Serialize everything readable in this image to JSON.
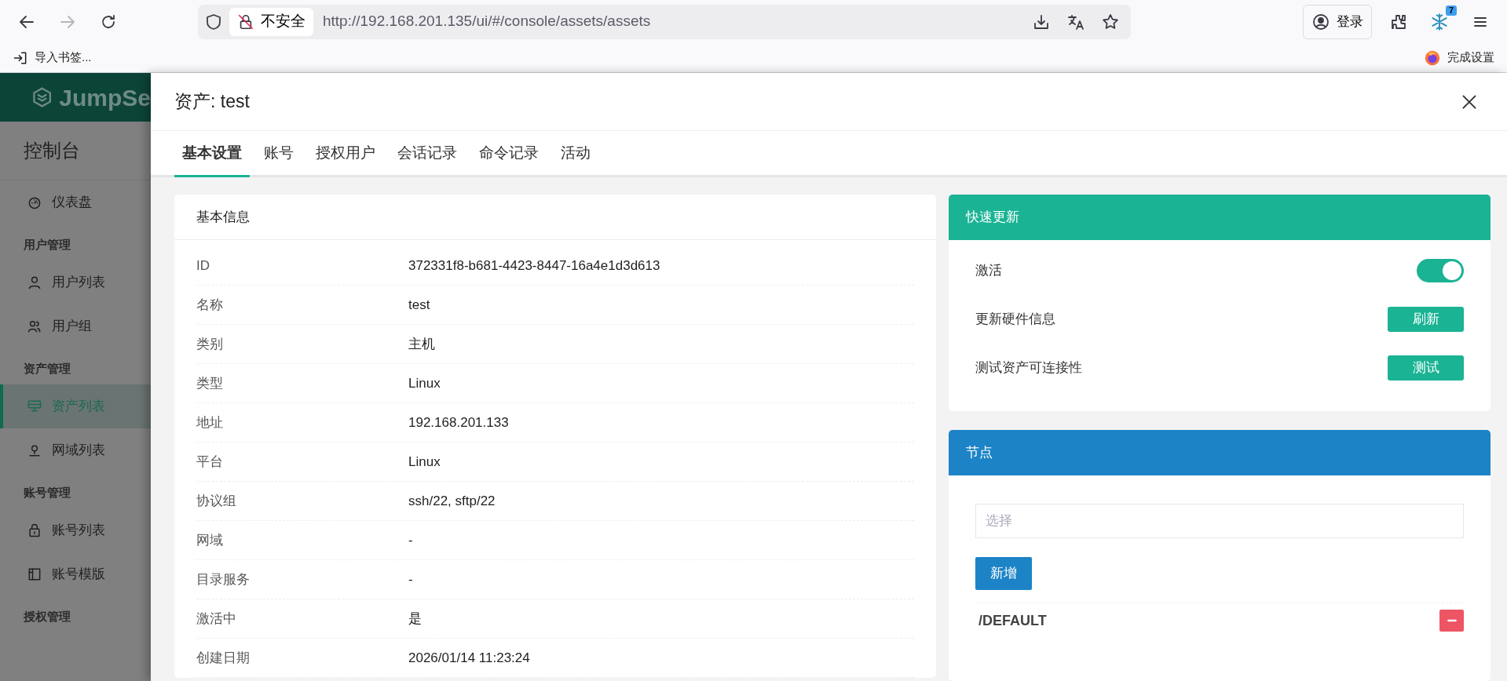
{
  "browser": {
    "nav_buttons": [
      {
        "kind": "back",
        "disabled": false
      },
      {
        "kind": "forward",
        "disabled": true
      },
      {
        "kind": "reload",
        "disabled": false
      }
    ],
    "security_label": "不安全",
    "url": "http://192.168.201.135/ui/#/console/assets/assets",
    "account_button": "登录",
    "extension_badge": "7",
    "import_bookmarks": "导入书签...",
    "setup_link": "完成设置"
  },
  "sidebar": {
    "logo": "JumpSe",
    "title": "控制台",
    "items": [
      {
        "kind": "item",
        "label": "仪表盘",
        "selected": false
      },
      {
        "kind": "heading",
        "label": "用户管理"
      },
      {
        "kind": "item",
        "label": "用户列表",
        "selected": false
      },
      {
        "kind": "item",
        "label": "用户组",
        "selected": false
      },
      {
        "kind": "heading",
        "label": "资产管理"
      },
      {
        "kind": "item",
        "label": "资产列表",
        "selected": true
      },
      {
        "kind": "item",
        "label": "网域列表",
        "selected": false
      },
      {
        "kind": "heading",
        "label": "账号管理"
      },
      {
        "kind": "item",
        "label": "账号列表",
        "selected": false
      },
      {
        "kind": "item",
        "label": "账号模版",
        "selected": false
      },
      {
        "kind": "heading",
        "label": "授权管理"
      }
    ]
  },
  "drawer": {
    "title": "资产: test",
    "tabs": [
      {
        "label": "基本设置",
        "selected": true
      },
      {
        "label": "账号",
        "selected": false
      },
      {
        "label": "授权用户",
        "selected": false
      },
      {
        "label": "会话记录",
        "selected": false
      },
      {
        "label": "命令记录",
        "selected": false
      },
      {
        "label": "活动",
        "selected": false
      }
    ],
    "basic_info": {
      "title": "基本信息",
      "rows": [
        {
          "label": "ID",
          "value": "372331f8-b681-4423-8447-16a4e1d3d613"
        },
        {
          "label": "名称",
          "value": "test"
        },
        {
          "label": "类别",
          "value": "主机"
        },
        {
          "label": "类型",
          "value": "Linux"
        },
        {
          "label": "地址",
          "value": "192.168.201.133"
        },
        {
          "label": "平台",
          "value": "Linux"
        },
        {
          "label": "协议组",
          "value": "ssh/22, sftp/22"
        },
        {
          "label": "网域",
          "value": "-"
        },
        {
          "label": "目录服务",
          "value": "-"
        },
        {
          "label": "激活中",
          "value": "是"
        },
        {
          "label": "创建日期",
          "value": "2026/01/14 11:23:24"
        }
      ]
    },
    "quick_update": {
      "title": "快速更新",
      "rows": [
        {
          "kind": "switch",
          "label": "激活",
          "on": true
        },
        {
          "kind": "button",
          "label": "更新硬件信息",
          "button": "刷新"
        },
        {
          "kind": "button",
          "label": "测试资产可连接性",
          "button": "测试"
        }
      ]
    },
    "nodes": {
      "title": "节点",
      "placeholder": "选择",
      "add_button": "新增",
      "items": [
        {
          "path": "/DEFAULT"
        }
      ]
    }
  }
}
